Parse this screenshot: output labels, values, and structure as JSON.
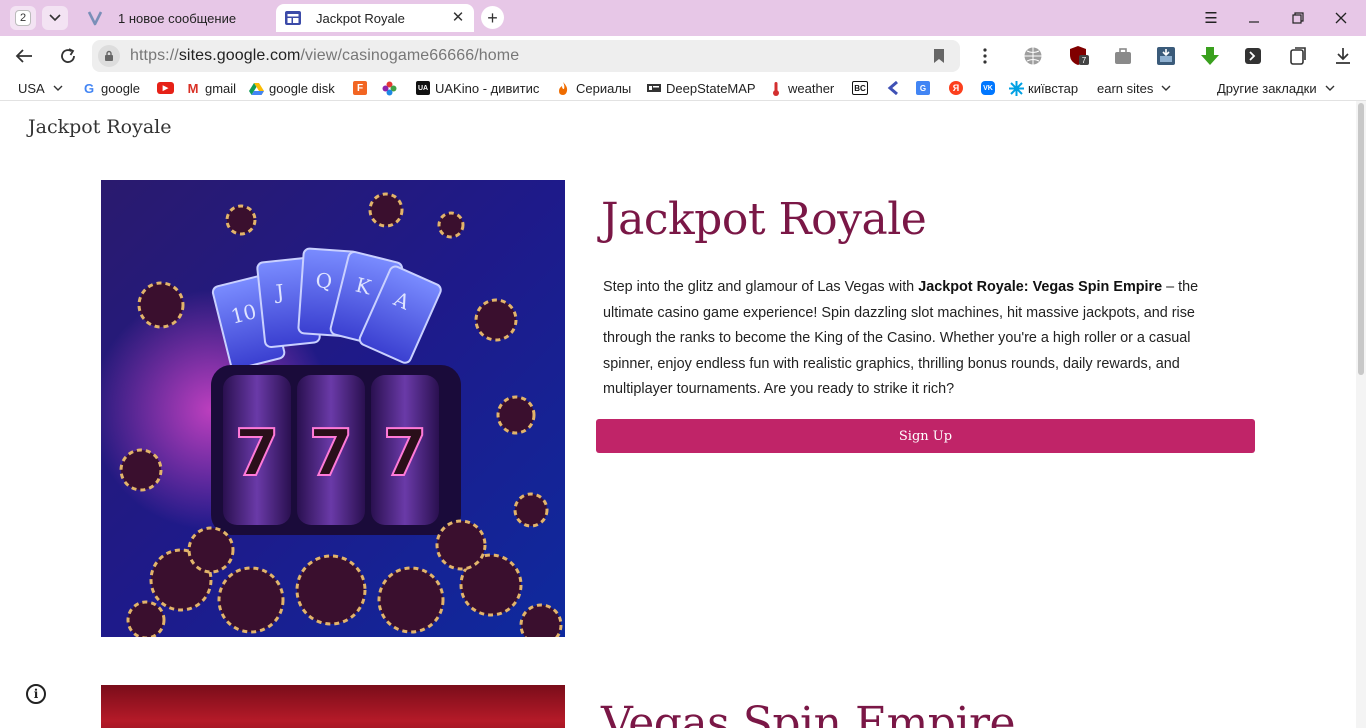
{
  "browser": {
    "tab_count": "2",
    "tabs": [
      {
        "title": "1 новое сообщение"
      },
      {
        "title": "Jackpot Royale"
      }
    ],
    "address": {
      "scheme": "https://",
      "host": "sites.google.com",
      "path": "/view/casinogame66666/home"
    },
    "bookmarks": [
      {
        "label": "USA",
        "icon": "chevron-down-icon"
      },
      {
        "label": "google",
        "icon": "google-icon"
      },
      {
        "label": "",
        "icon": "youtube-icon"
      },
      {
        "label": "gmail",
        "icon": "gmail-icon"
      },
      {
        "label": "google disk",
        "icon": "google-drive-icon"
      },
      {
        "label": "",
        "icon": "f-icon"
      },
      {
        "label": "",
        "icon": "flower-icon"
      },
      {
        "label": "UAKino - дивитис",
        "icon": "uakino-icon"
      },
      {
        "label": "Сериалы",
        "icon": "fire-icon"
      },
      {
        "label": "DeepStateMAP",
        "icon": "deepstate-icon"
      },
      {
        "label": "weather",
        "icon": "thermometer-icon"
      },
      {
        "label": "",
        "icon": "bc-icon"
      },
      {
        "label": "",
        "icon": "arrow-icon"
      },
      {
        "label": "",
        "icon": "translate-icon"
      },
      {
        "label": "",
        "icon": "yandex-icon"
      },
      {
        "label": "",
        "icon": "vk-icon"
      },
      {
        "label": "київстар",
        "icon": "kyivstar-icon"
      },
      {
        "label": "earn sites",
        "icon": "chevron-down-icon"
      },
      {
        "label": "Другие закладки",
        "icon": "chevron-down-icon"
      }
    ],
    "colors": {
      "tabstrip": "#e7c7e7",
      "active_tab": "#ffffff"
    }
  },
  "page": {
    "site_name": "Jackpot Royale",
    "hero": {
      "title": "Jackpot Royale",
      "text_before": "Step into the glitz and glamour of Las Vegas with ",
      "text_bold": "Jackpot Royale: Vegas Spin Empire",
      "text_after": " – the ultimate casino game experience! Spin dazzling slot machines, hit massive jackpots, and rise through the ranks to become the King of the Casino. Whether you're a high roller or a casual spinner, enjoy endless fun with realistic graphics, thrilling bonus rounds, daily rewards, and multiplayer tournaments. Are you ready to strike it rich?",
      "button_label": "Sign Up",
      "image_cards": [
        "10",
        "J",
        "Q",
        "K",
        "A"
      ],
      "image_reels": [
        "7",
        "7",
        "7"
      ]
    },
    "second_section": {
      "title": "Vegas Spin Empire"
    },
    "colors": {
      "title": "#7a1746",
      "button": "#c02468"
    }
  }
}
